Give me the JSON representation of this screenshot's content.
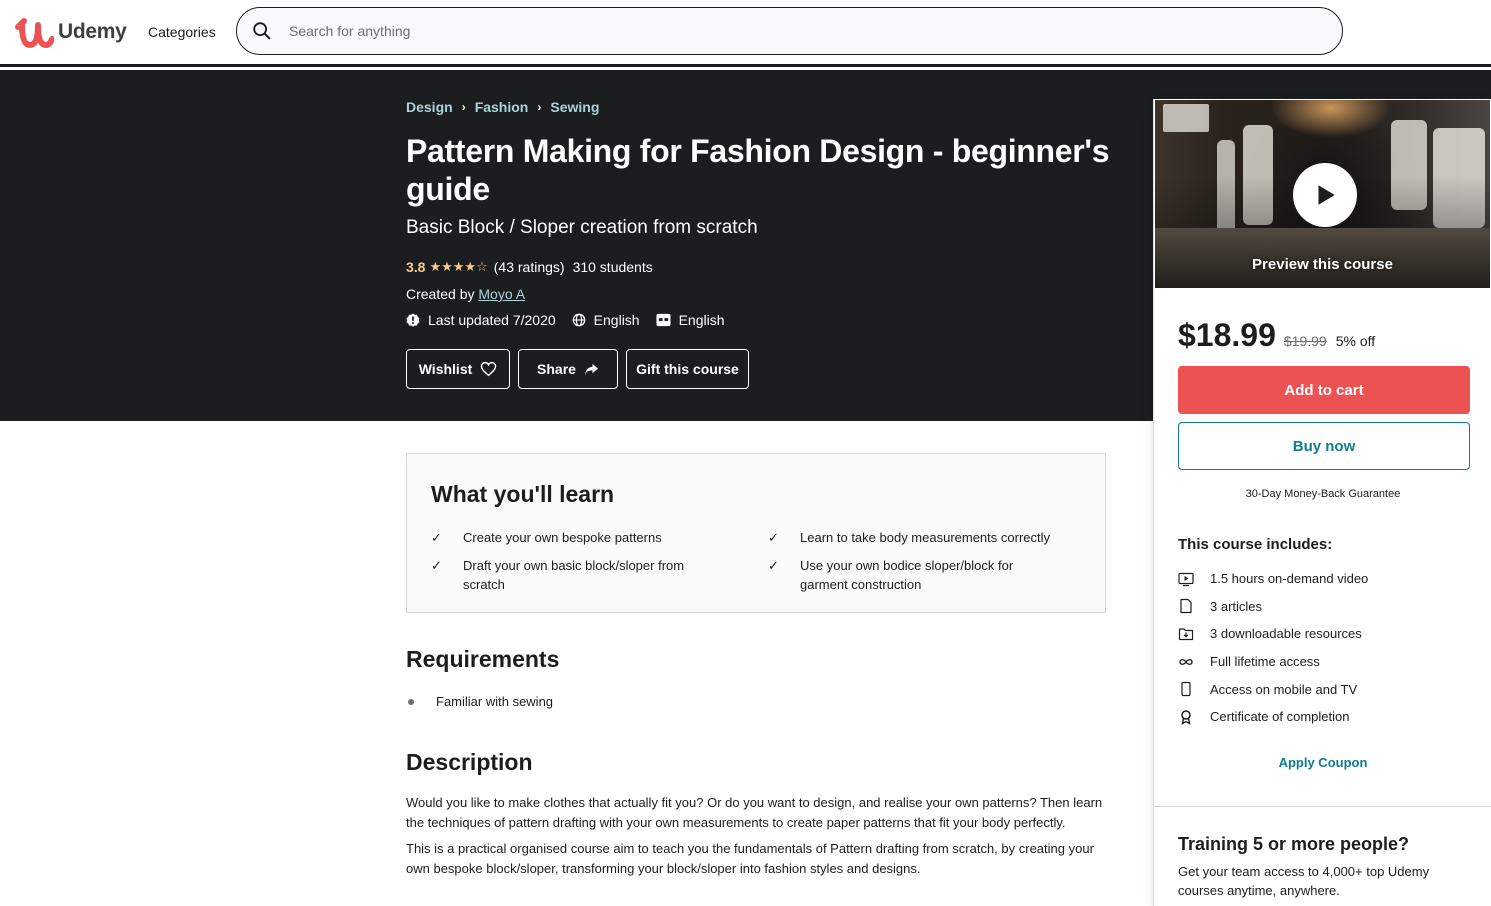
{
  "header": {
    "brand": "Udemy",
    "categories_label": "Categories",
    "search_placeholder": "Search for anything",
    "search_value": ""
  },
  "hero": {
    "breadcrumb": [
      "Design",
      "Fashion",
      "Sewing"
    ],
    "title": "Pattern Making for Fashion Design - beginner's guide",
    "subtitle": "Basic Block / Sloper creation from scratch",
    "rating": "3.8",
    "stars_filled": 4,
    "stars_total": 5,
    "stars_display": "★★★★☆",
    "ratings_count": "(43 ratings)",
    "students": "310 students",
    "created_by_label": "Created by",
    "author": "Moyo A",
    "last_updated": "Last updated 7/2020",
    "language": "English",
    "captions": "English",
    "buttons": {
      "wishlist": "Wishlist",
      "share": "Share",
      "gift": "Gift this course"
    }
  },
  "sidebar": {
    "preview_label": "Preview this course",
    "price": "$18.99",
    "original_price": "$19.99",
    "discount": "5% off",
    "add_to_cart": "Add to cart",
    "buy_now": "Buy now",
    "guarantee": "30-Day Money-Back Guarantee",
    "includes_title": "This course includes:",
    "includes": [
      {
        "icon": "video-icon",
        "label": "1.5 hours on-demand video"
      },
      {
        "icon": "article-icon",
        "label": "3 articles"
      },
      {
        "icon": "download-folder-icon",
        "label": "3 downloadable resources"
      },
      {
        "icon": "infinity-icon",
        "label": "Full lifetime access"
      },
      {
        "icon": "mobile-icon",
        "label": "Access on mobile and TV"
      },
      {
        "icon": "certificate-icon",
        "label": "Certificate of completion"
      }
    ],
    "apply_coupon": "Apply Coupon",
    "training_title": "Training 5 or more people?",
    "training_text": "Get your team access to 4,000+ top Udemy courses anytime, anywhere."
  },
  "learn": {
    "title": "What you'll learn",
    "items": [
      "Create your own bespoke patterns",
      "Learn to take body measurements correctly",
      "Draft your own basic block/sloper from scratch",
      "Use your own bodice sloper/block for garment construction"
    ]
  },
  "requirements": {
    "title": "Requirements",
    "items": [
      "Familiar with sewing"
    ]
  },
  "description": {
    "title": "Description",
    "paragraphs": [
      "Would you like to make clothes that actually fit you? Or do you want to design, and realise your own patterns? Then learn the techniques of pattern drafting with your own measurements to create paper patterns that fit your body perfectly.",
      "This is a practical organised course aim to teach you the fundamentals of Pattern drafting from scratch, by creating your own bespoke block/sloper, transforming your block/sloper into fashion styles and designs."
    ]
  },
  "colors": {
    "brand_red": "#ec5252",
    "hero_bg": "#1c1d1f",
    "link_teal": "#0f7c90",
    "breadcrumb_link": "#a8d3dd",
    "star_gold": "#f3ca8c"
  }
}
